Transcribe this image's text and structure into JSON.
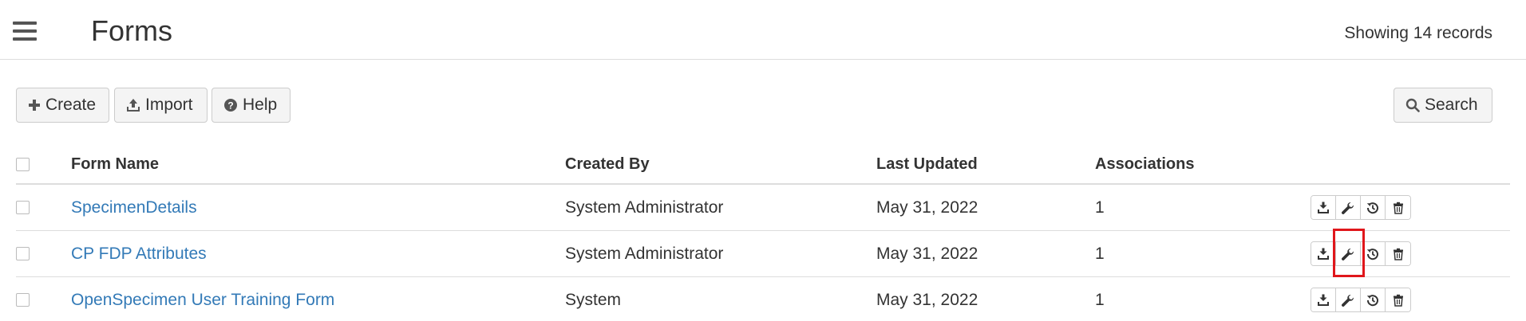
{
  "header": {
    "title": "Forms",
    "record_count": "Showing 14 records"
  },
  "toolbar": {
    "create_label": "Create",
    "import_label": "Import",
    "help_label": "Help",
    "search_label": "Search"
  },
  "table": {
    "columns": [
      "Form Name",
      "Created By",
      "Last Updated",
      "Associations"
    ],
    "rows": [
      {
        "name": "SpecimenDetails",
        "created_by": "System Administrator",
        "last_updated": "May 31, 2022",
        "associations": "1"
      },
      {
        "name": "CP FDP Attributes",
        "created_by": "System Administrator",
        "last_updated": "May 31, 2022",
        "associations": "1"
      },
      {
        "name": "OpenSpecimen User Training Form",
        "created_by": "System",
        "last_updated": "May 31, 2022",
        "associations": "1"
      }
    ]
  },
  "icons": {
    "menu": "hamburger-icon",
    "create": "plus-icon",
    "import": "upload-icon",
    "help": "question-circle-icon",
    "search": "search-icon",
    "row_actions": [
      "download-icon",
      "wrench-icon",
      "history-icon",
      "trash-icon"
    ]
  },
  "colors": {
    "link": "#337ab7",
    "highlight": "#e0161b"
  }
}
